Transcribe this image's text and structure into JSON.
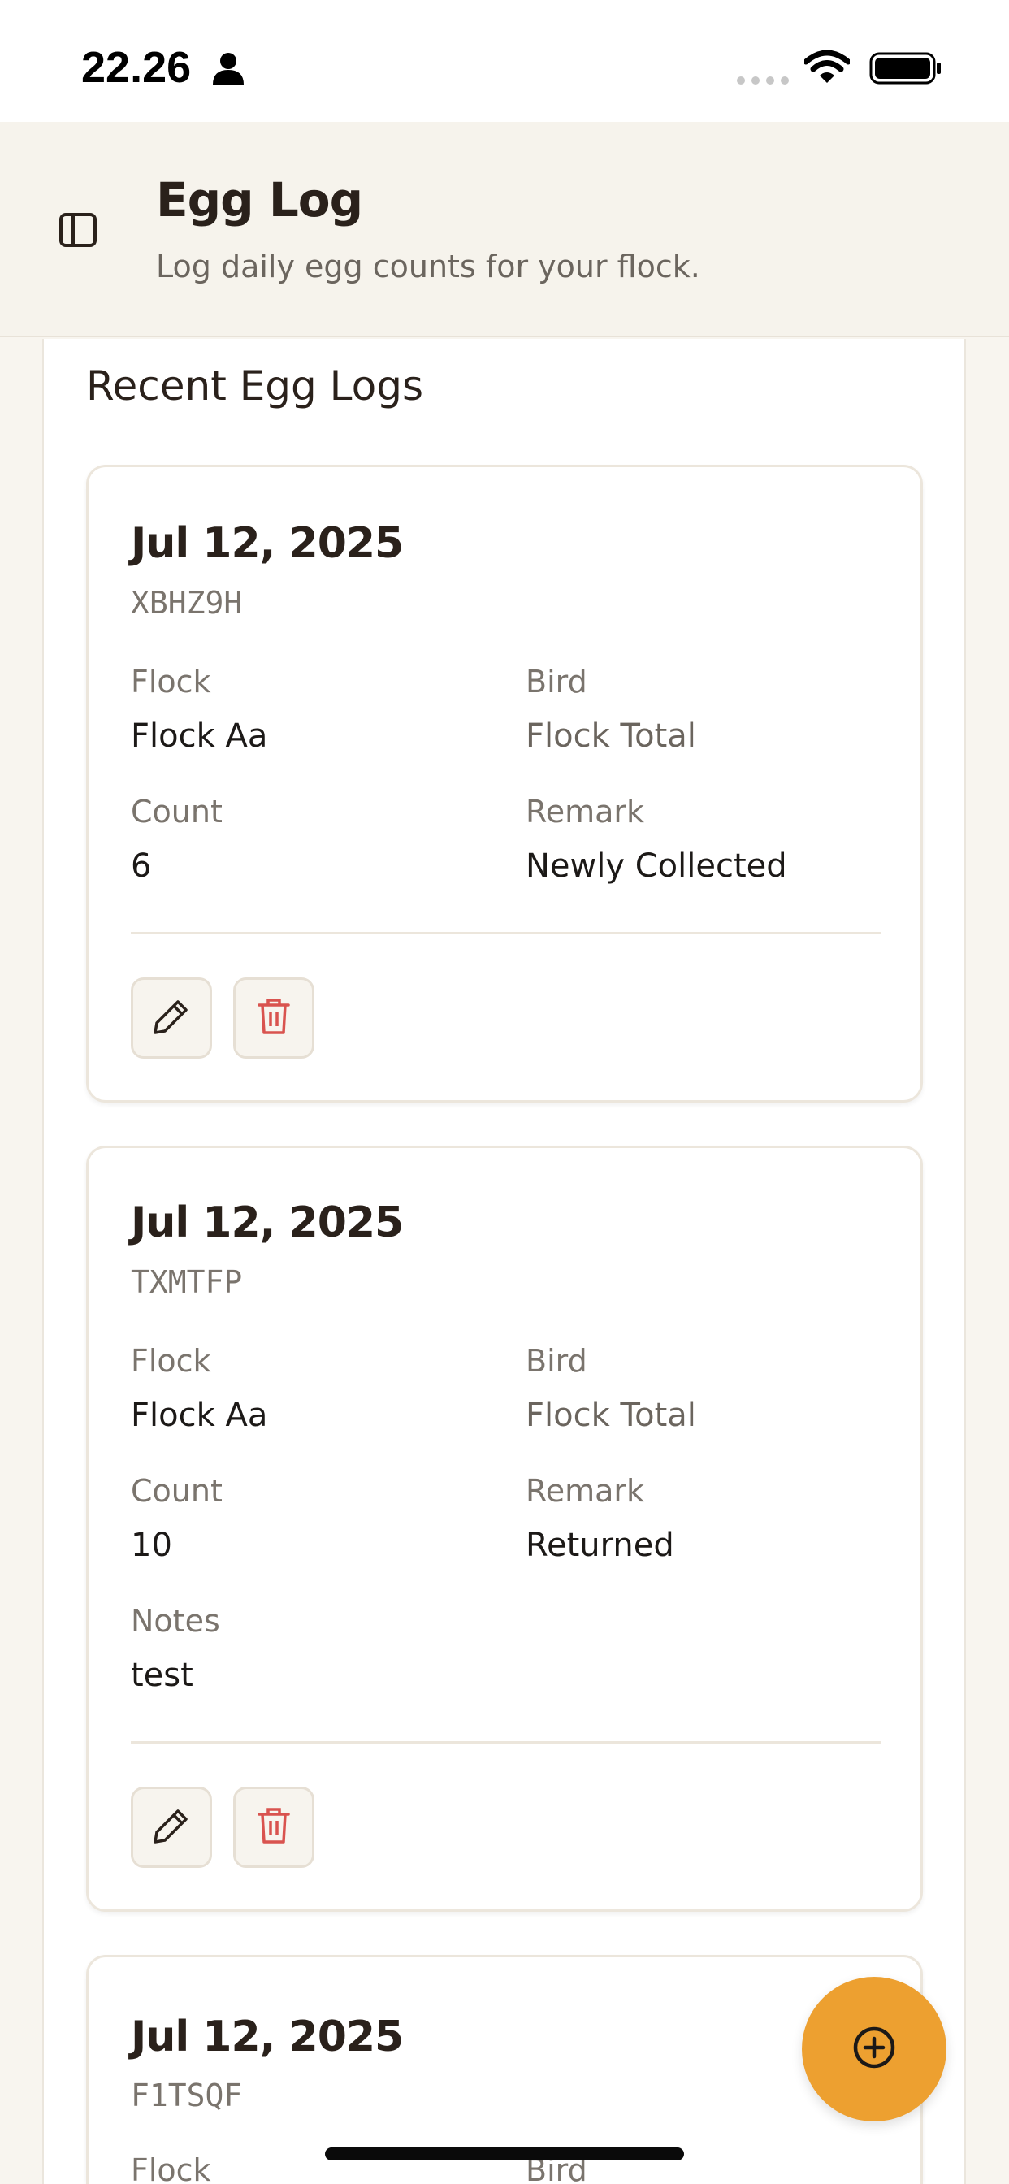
{
  "status_bar": {
    "time": "22.26"
  },
  "header": {
    "title": "Egg Log",
    "subtitle": "Log daily egg counts for your flock."
  },
  "section": {
    "title": "Recent Egg Logs"
  },
  "logs": [
    {
      "date": "Jul 12, 2025",
      "code": "XBHZ9H",
      "flock_label": "Flock",
      "flock": "Flock Aa",
      "bird_label": "Bird",
      "bird": "Flock Total",
      "count_label": "Count",
      "count": "6",
      "remark_label": "Remark",
      "remark": "Newly Collected"
    },
    {
      "date": "Jul 12, 2025",
      "code": "TXMTFP",
      "flock_label": "Flock",
      "flock": "Flock Aa",
      "bird_label": "Bird",
      "bird": "Flock Total",
      "count_label": "Count",
      "count": "10",
      "remark_label": "Remark",
      "remark": "Returned",
      "notes_label": "Notes",
      "notes": "test"
    },
    {
      "date": "Jul 12, 2025",
      "code": "F1TSQF",
      "flock_label": "Flock",
      "bird_label": "Bird"
    }
  ],
  "icons": {
    "sidebar_toggle": "sidebar-toggle-icon",
    "edit": "pencil-icon",
    "delete": "trash-icon",
    "fab": "plus-circle-icon"
  },
  "colors": {
    "accent": "#eda030",
    "delete": "#d9534f",
    "background": "#f8f5ef"
  }
}
